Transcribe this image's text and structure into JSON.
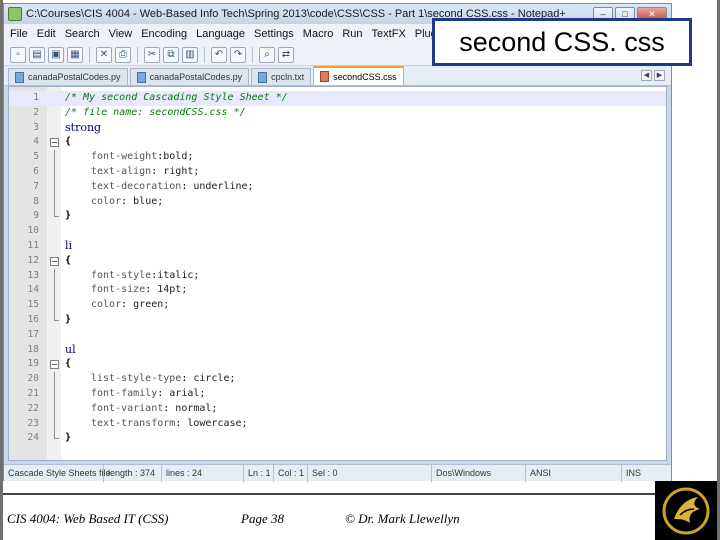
{
  "window": {
    "title": "C:\\Courses\\CIS 4004 - Web-Based Info Tech\\Spring 2013\\code\\CSS\\CSS - Part 1\\second CSS.css - Notepad++",
    "buttons": {
      "minimize": "–",
      "maximize": "□",
      "close": "✕"
    }
  },
  "menu": [
    "File",
    "Edit",
    "Search",
    "View",
    "Encoding",
    "Language",
    "Settings",
    "Macro",
    "Run",
    "TextFX",
    "Plugins"
  ],
  "toolbar_icons": [
    "new-file-icon",
    "open-file-icon",
    "save-icon",
    "save-all-icon",
    "close-file-icon",
    "print-icon",
    "cut-icon",
    "copy-icon",
    "paste-icon",
    "undo-icon",
    "redo-icon",
    "find-icon",
    "replace-icon"
  ],
  "tabs": [
    {
      "label": "canadaPostalCodes.py",
      "active": false,
      "modified": false
    },
    {
      "label": "canadaPostalCodes.py",
      "active": false,
      "modified": false
    },
    {
      "label": "cpcln.txt",
      "active": false,
      "modified": false
    },
    {
      "label": "secondCSS.css",
      "active": true,
      "modified": true
    }
  ],
  "editor": {
    "current_line": 1,
    "lines": [
      {
        "n": "1",
        "fold": "none",
        "text": "/* My second Cascading Style Sheet */",
        "kind": "comment"
      },
      {
        "n": "2",
        "fold": "none",
        "text": "/* file name: secondCSS.css */",
        "kind": "comment"
      },
      {
        "n": "3",
        "fold": "none",
        "text": "strong",
        "kind": "selector"
      },
      {
        "n": "4",
        "fold": "box",
        "text": "{",
        "kind": "brace"
      },
      {
        "n": "5",
        "fold": "line",
        "prop": "font-weight",
        "val": "bold;",
        "kind": "decl"
      },
      {
        "n": "6",
        "fold": "line",
        "prop": "text-align",
        "val": " right;",
        "kind": "decl"
      },
      {
        "n": "7",
        "fold": "line",
        "prop": "text-decoration",
        "val": " underline;",
        "kind": "decl"
      },
      {
        "n": "8",
        "fold": "line",
        "prop": "color",
        "val": " blue;",
        "kind": "decl"
      },
      {
        "n": "9",
        "fold": "end",
        "text": "}",
        "kind": "brace"
      },
      {
        "n": "10",
        "fold": "none",
        "text": "",
        "kind": "blank"
      },
      {
        "n": "11",
        "fold": "none",
        "text": "li",
        "kind": "selector"
      },
      {
        "n": "12",
        "fold": "box",
        "text": "{",
        "kind": "brace"
      },
      {
        "n": "13",
        "fold": "line",
        "prop": "font-style",
        "val": "italic;",
        "kind": "decl"
      },
      {
        "n": "14",
        "fold": "line",
        "prop": "font-size",
        "val": " 14pt;",
        "kind": "decl"
      },
      {
        "n": "15",
        "fold": "line",
        "prop": "color",
        "val": " green;",
        "kind": "decl"
      },
      {
        "n": "16",
        "fold": "end",
        "text": "}",
        "kind": "brace"
      },
      {
        "n": "17",
        "fold": "none",
        "text": "",
        "kind": "blank"
      },
      {
        "n": "18",
        "fold": "none",
        "text": "ul",
        "kind": "selector"
      },
      {
        "n": "19",
        "fold": "box",
        "text": "{",
        "kind": "brace"
      },
      {
        "n": "20",
        "fold": "line",
        "prop": "list-style-type",
        "val": " circle;",
        "kind": "decl"
      },
      {
        "n": "21",
        "fold": "line",
        "prop": "font-family",
        "val": " arial;",
        "kind": "decl"
      },
      {
        "n": "22",
        "fold": "line",
        "prop": "font-variant",
        "val": " normal;",
        "kind": "decl"
      },
      {
        "n": "23",
        "fold": "line",
        "prop": "text-transform",
        "val": " lowercase;",
        "kind": "decl"
      },
      {
        "n": "24",
        "fold": "end",
        "text": "}",
        "kind": "brace"
      }
    ]
  },
  "status": {
    "file_type": "Cascade Style Sheets file",
    "length": "length : 374",
    "lines": "lines : 24",
    "ln": "Ln : 1",
    "col": "Col : 1",
    "sel": "Sel : 0",
    "eol": "Dos\\Windows",
    "encoding": "ANSI",
    "mode": "INS"
  },
  "slide": {
    "title": "second CSS. css",
    "footer_course": "CIS 4004: Web Based IT (CSS)",
    "footer_page": "Page 38",
    "footer_author": "© Dr. Mark Llewellyn"
  },
  "colors": {
    "title_border": "#1d3a8a",
    "comment": "#008000",
    "selector": "#000080",
    "current_line": "#e8e8ff"
  }
}
